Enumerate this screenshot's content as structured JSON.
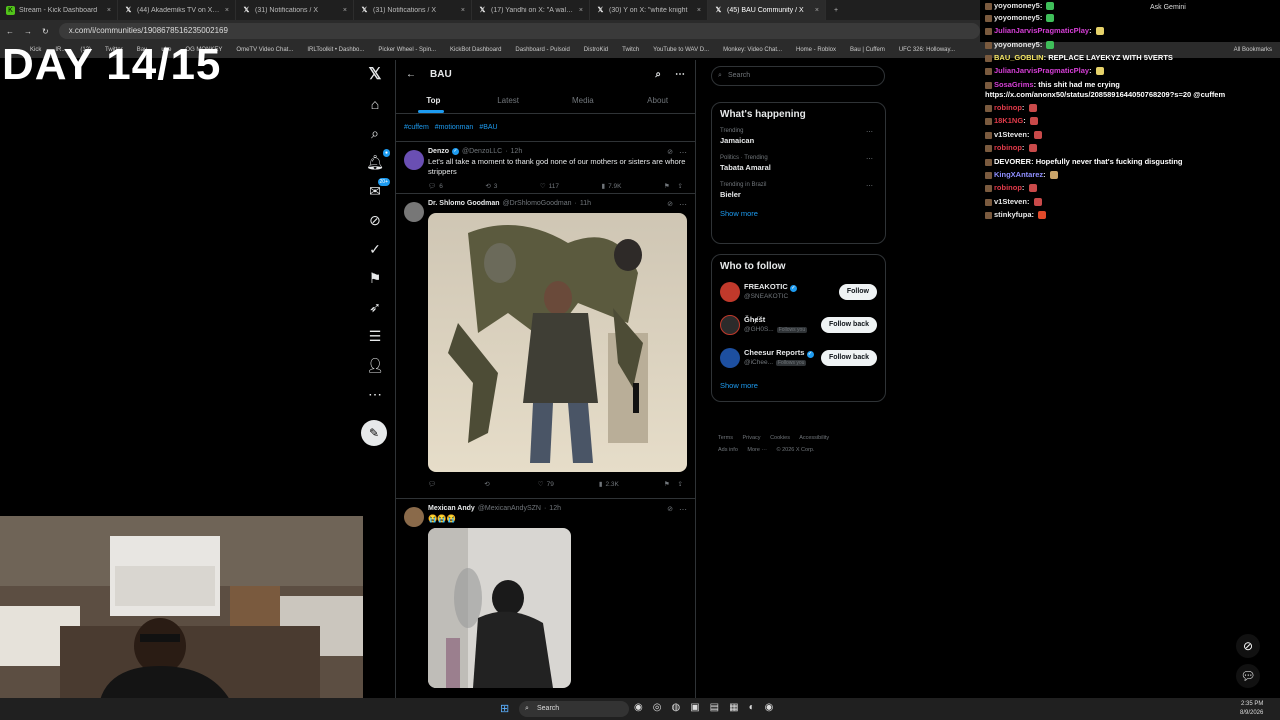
{
  "browser": {
    "tabs": [
      {
        "label": "Stream - Kick Dashboard",
        "icon": "kick-icon"
      },
      {
        "label": "(44) Akademiks TV on X: \"Alab",
        "icon": "x-icon"
      },
      {
        "label": "(31) Notifications / X",
        "icon": "x-icon"
      },
      {
        "label": "(31) Notifications / X",
        "icon": "x-icon"
      },
      {
        "label": "(17) Yandhi on X: \"A walking p",
        "icon": "x-icon"
      },
      {
        "label": "(30) Y on X: \"white knight",
        "icon": "x-icon"
      },
      {
        "label": "(45) BAU Community / X",
        "icon": "x-icon"
      }
    ],
    "url": "x.com/i/communities/1908678516235002169",
    "ask_gemini": "Ask Gemini",
    "bookmarks": [
      "Kick",
      "IR...",
      "(12)",
      "Twitter",
      "Bau",
      "ube",
      "OG MONKEY",
      "OmeTV Video Chat...",
      "IRLToolkit • Dashbo...",
      "Picker Wheel - Spin...",
      "KickBot Dashboard",
      "Dashboard - Pulsoid",
      "DistroKid",
      "Twitch",
      "YouTube to WAV D...",
      "Monkey: Video Chat...",
      "Home - Roblox",
      "Bau | Cuffem",
      "UFC 326: Holloway..."
    ],
    "all_bookmarks": "All Bookmarks"
  },
  "overlay": {
    "title": "DAY 14/15"
  },
  "community": {
    "name": "BAU",
    "tabs": [
      "Top",
      "Latest",
      "Media",
      "About"
    ],
    "active_tab": "Top",
    "hashtags": [
      "#cuffem",
      "#motionman",
      "#BAU"
    ]
  },
  "tweets": [
    {
      "name": "Denzo",
      "handle": "@DenzoLLC",
      "time": "12h",
      "verified": true,
      "text": "Let's all take a moment to thank god none of our mothers or sisters are whore strippers",
      "replies": "6",
      "reposts": "3",
      "likes": "117",
      "views": "7.9K"
    },
    {
      "name": "Dr. Shlomo Goodman",
      "handle": "@DrShlomoGoodman",
      "time": "11h",
      "verified": false,
      "text": "",
      "replies": "",
      "reposts": "",
      "likes": "79",
      "views": "2.3K"
    },
    {
      "name": "Mexican Andy",
      "handle": "@MexicanAndySZN",
      "time": "12h",
      "verified": false,
      "text": "😭😭😭",
      "replies": "",
      "reposts": "",
      "likes": "",
      "views": ""
    }
  ],
  "right": {
    "search_placeholder": "Search",
    "happening_title": "What's happening",
    "trends": [
      {
        "context": "Trending",
        "topic": "Jamaican"
      },
      {
        "context": "Politics · Trending",
        "topic": "Tabata Amaral"
      },
      {
        "context": "Trending in Brazil",
        "topic": "Bieler"
      }
    ],
    "show_more": "Show more",
    "who_to_follow_title": "Who to follow",
    "follow": [
      {
        "name": "FREAKOTIC",
        "handle": "@SNEAKOTIC",
        "follows_you": "",
        "button": "Follow",
        "color": "#c0392b"
      },
      {
        "name": "Ğhɇšt",
        "handle": "@GH0S...",
        "follows_you": "Follows you",
        "button": "Follow back",
        "color": "#2b2b2b"
      },
      {
        "name": "Cheesur Reports",
        "handle": "@iChee...",
        "follows_you": "Follows you",
        "button": "Follow back",
        "color": "#1d4fa0"
      }
    ],
    "show_more_2": "Show more",
    "footer_line1": [
      "Terms",
      "Privacy",
      "Cookies",
      "Accessibility"
    ],
    "footer_line2": [
      "Ads info",
      "More ···",
      "© 2026 X Corp."
    ]
  },
  "chat": [
    {
      "user": "yoyomoney5",
      "color": "#e8e8e8",
      "text": "",
      "emote": "#3fbf5a"
    },
    {
      "user": "yoyomoney5",
      "color": "#e8e8e8",
      "text": "",
      "emote": "#3fbf5a"
    },
    {
      "user": "JulianJarvisPragmaticPlay",
      "color": "#d63fd6",
      "text": "",
      "emote": "#e6d26a"
    },
    {
      "user": "yoyomoney5",
      "color": "#e8e8e8",
      "text": "",
      "emote": "#3fbf5a"
    },
    {
      "user": "BAU_GOBLIN",
      "color": "#f5e663",
      "text": "REPLACE LAYEKYZ WITH 5VERTS",
      "emote": ""
    },
    {
      "user": "JulianJarvisPragmaticPlay",
      "color": "#d63fd6",
      "text": "",
      "emote": "#e6d26a"
    },
    {
      "user": "SosaGrims",
      "color": "#d63fd6",
      "text": "this shit had me crying",
      "emote": ""
    },
    {
      "user": "",
      "color": "#ffffff",
      "text": "https://x.com/anonx50/status/2085891644050768209?s=20 @cuffem",
      "emote": ""
    },
    {
      "user": "robinop",
      "color": "#e23b4a",
      "text": "",
      "emote": "#c94a4a"
    },
    {
      "user": "18K1NG",
      "color": "#e23b4a",
      "text": "",
      "emote": "#c94a4a"
    },
    {
      "user": "v1Steven",
      "color": "#e8e8e8",
      "text": "",
      "emote": "#c94a4a"
    },
    {
      "user": "robinop",
      "color": "#e23b4a",
      "text": "",
      "emote": "#c94a4a"
    },
    {
      "user": "DEVORER",
      "color": "#ffffff",
      "text": "Hopefully never that's fucking disgusting",
      "emote": ""
    },
    {
      "user": "KingXAntarez",
      "color": "#8f8fff",
      "text": "",
      "emote": "#c9a46a"
    },
    {
      "user": "robinop",
      "color": "#e23b4a",
      "text": "",
      "emote": "#c94a4a"
    },
    {
      "user": "v1Steven",
      "color": "#e8e8e8",
      "text": "",
      "emote": "#c94a4a"
    },
    {
      "user": "stinkyfupa",
      "color": "#e8e8e8",
      "text": "",
      "emote": "#e24a2a"
    }
  ],
  "taskbar": {
    "search": "Search",
    "time": "2:35 PM",
    "date": "8/9/2026"
  }
}
